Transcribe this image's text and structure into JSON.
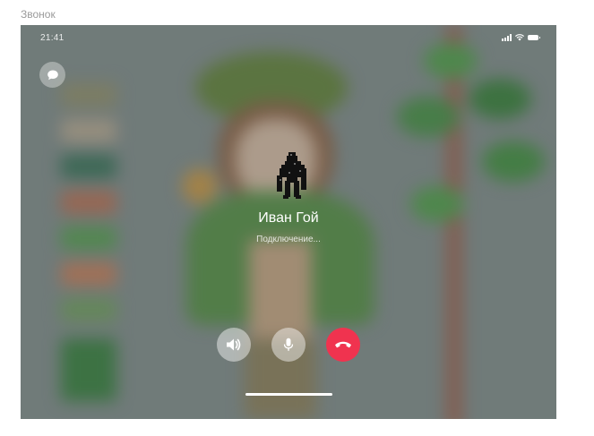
{
  "frame": {
    "label": "Звонок"
  },
  "status_bar": {
    "time": "21:41"
  },
  "caller": {
    "name": "Иван Гой",
    "status": "Подключение..."
  },
  "icons": {
    "chat": "chat-bubble-icon",
    "speaker": "speaker-icon",
    "mic": "microphone-icon",
    "end_call": "phone-hangup-icon"
  },
  "colors": {
    "end_call": "#f0334f",
    "text": "#ffffff"
  }
}
